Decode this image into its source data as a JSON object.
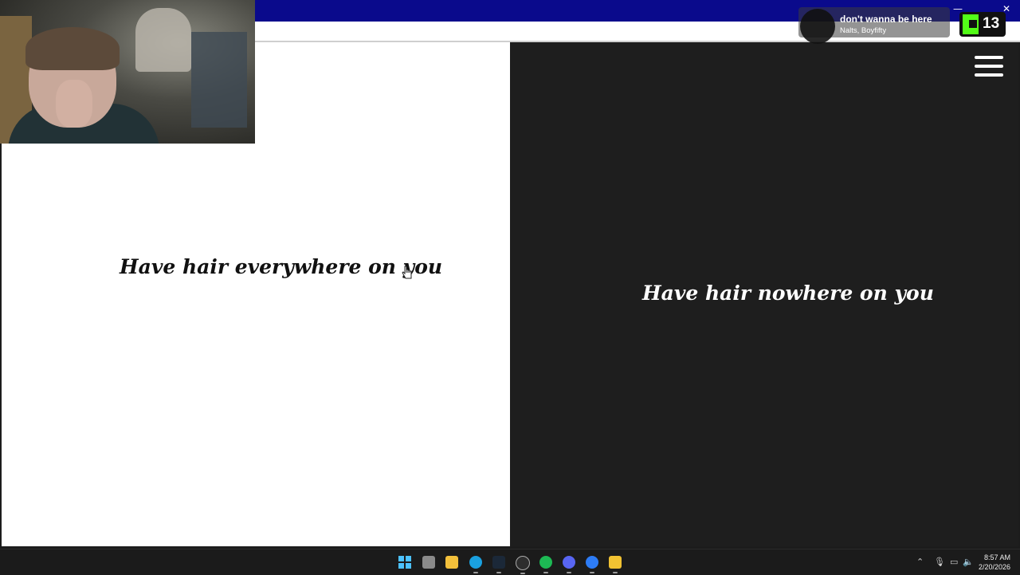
{
  "window": {
    "minimize": "—",
    "close": "✕"
  },
  "game": {
    "left_option": "Have hair everywhere on you",
    "right_option": "Have hair nowhere on you"
  },
  "now_playing": {
    "song": "don't wanna be here",
    "artist": "Nalts, Boyfifty"
  },
  "kick": {
    "viewer_count": "13"
  },
  "taskbar": {
    "icons": [
      "windows-start-icon",
      "file-icon",
      "file-explorer-icon",
      "edge-icon",
      "steam-icon",
      "obs-icon",
      "spotify-icon",
      "discord-icon",
      "app-icon",
      "pen-app-icon"
    ],
    "clock_time": "8:57 AM",
    "clock_date": "2/20/2026"
  }
}
